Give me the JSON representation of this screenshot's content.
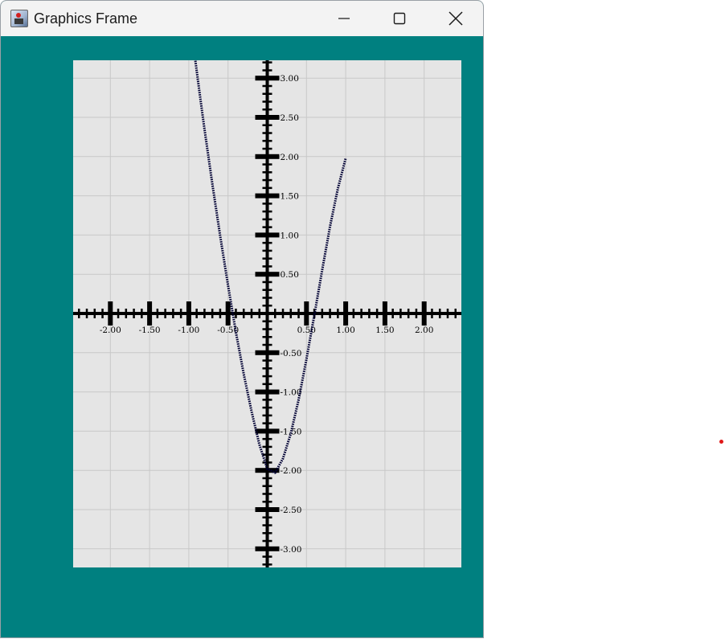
{
  "window": {
    "title": "Graphics Frame",
    "background": "#008080",
    "icons": {
      "app": "java-duke-icon",
      "minimize": "minimize-icon",
      "maximize": "maximize-icon",
      "close": "close-icon"
    }
  },
  "chart_data": {
    "type": "line",
    "title": "",
    "xlabel": "",
    "ylabel": "",
    "xlim": [
      -2.48,
      2.48
    ],
    "ylim": [
      -3.22,
      3.22
    ],
    "grid": true,
    "background": "#e5e5e5",
    "grid_color": "#c8c8c8",
    "axis_color": "#000000",
    "curve_color": "#000033",
    "x_ticks": [
      -2.0,
      -1.5,
      -1.0,
      -0.5,
      0.5,
      1.0,
      1.5,
      2.0
    ],
    "x_tick_labels": [
      "-2.00",
      "-1.50",
      "-1.00",
      "-0.50",
      "0.50",
      "1.00",
      "1.50",
      "2.00"
    ],
    "y_ticks": [
      3.0,
      2.5,
      2.0,
      1.5,
      1.0,
      0.5,
      -0.5,
      -1.0,
      -1.5,
      -2.0,
      -2.5,
      -3.0
    ],
    "y_tick_labels": [
      "3.00",
      "2.50",
      "2.00",
      "1.50",
      "1.00",
      "0.50",
      "-0.50",
      "-1.00",
      "-1.50",
      "-2.00",
      "-2.50",
      "-3.00"
    ],
    "minor_tick_step": 0.1,
    "series": [
      {
        "style": "dotted",
        "x": [
          -0.92,
          -0.85,
          -0.8,
          -0.7,
          -0.6,
          -0.5,
          -0.4,
          -0.3,
          -0.2,
          -0.1,
          0.0,
          0.1,
          0.2,
          0.3,
          0.4,
          0.5,
          0.6,
          0.7,
          0.8,
          0.9,
          1.0
        ],
        "y": [
          3.25,
          2.72,
          2.35,
          1.65,
          0.99,
          0.36,
          -0.24,
          -0.77,
          -1.25,
          -1.67,
          -1.98,
          -2.03,
          -1.85,
          -1.53,
          -1.1,
          -0.58,
          -0.02,
          0.55,
          1.11,
          1.59,
          1.98
        ]
      }
    ]
  }
}
